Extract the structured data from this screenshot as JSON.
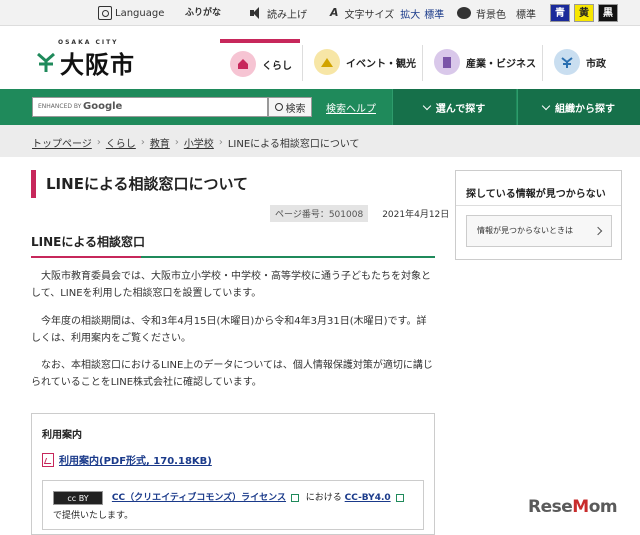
{
  "utility_bar": {
    "language": "Language",
    "furigana": "ふりがな",
    "read_aloud": "読み上げ",
    "text_size": "文字サイズ",
    "enlarge": "拡大",
    "standard": "標準",
    "bg_color": "背景色",
    "bg_standard": "標準",
    "color_blue": "青",
    "color_yellow": "黄",
    "color_black": "黒",
    "furigana_icon": "ふりがな",
    "text_size_icon": "A"
  },
  "header": {
    "logo_sub": "OSAKA CITY",
    "logo_text": "大阪市",
    "nav": [
      {
        "label": "くらし",
        "icon": "house-icon",
        "color": "#f6c4d3"
      },
      {
        "label": "イベント・観光",
        "icon": "event-icon",
        "color": "#f7e6a6"
      },
      {
        "label": "産業・ビジネス",
        "icon": "building-icon",
        "color": "#d9c8ea"
      },
      {
        "label": "市政",
        "icon": "city-icon",
        "color": "#c9def0"
      }
    ]
  },
  "search": {
    "enhanced_by": "ENHANCED BY",
    "google": "Google",
    "button": "検索",
    "help": "検索ヘルプ"
  },
  "green_menu": {
    "choose": "選んで探す",
    "org": "組織から探す"
  },
  "breadcrumb": [
    "トップページ",
    "くらし",
    "教育",
    "小学校",
    "LINEによる相談窓口について"
  ],
  "main": {
    "title": "LINEによる相談窓口について",
    "page_number": "ページ番号：501008",
    "date": "2021年4月12日",
    "section_heading": "LINEによる相談窓口",
    "paragraphs": [
      "大阪市教育委員会では、大阪市立小学校・中学校・高等学校に通う子どもたちを対象として、LINEを利用した相談窓口を設置しています。",
      "今年度の相談期間は、令和3年4月15日(木曜日)から令和4年3月31日(木曜日)です。詳しくは、利用案内をご覧ください。",
      "なお、本相談窓口におけるLINE上のデータについては、個人情報保護対策が適切に講じられていることをLINE株式会社に確認しています。"
    ],
    "info_title": "利用案内",
    "pdf_link": "利用案内(PDF形式, 170.18KB)",
    "cc_badge": "cc BY",
    "license_link": "CC（クリエイティブコモンズ）ライセンス",
    "license_mid": "における",
    "license_by": "CC-BY4.0",
    "license_tail": "で提供いたします。"
  },
  "sidebar": {
    "title": "探している情報が見つからない",
    "button": "情報が見つからないときは"
  },
  "watermark": {
    "prefix": "Rese",
    "accent": "M",
    "suffix": "om"
  }
}
